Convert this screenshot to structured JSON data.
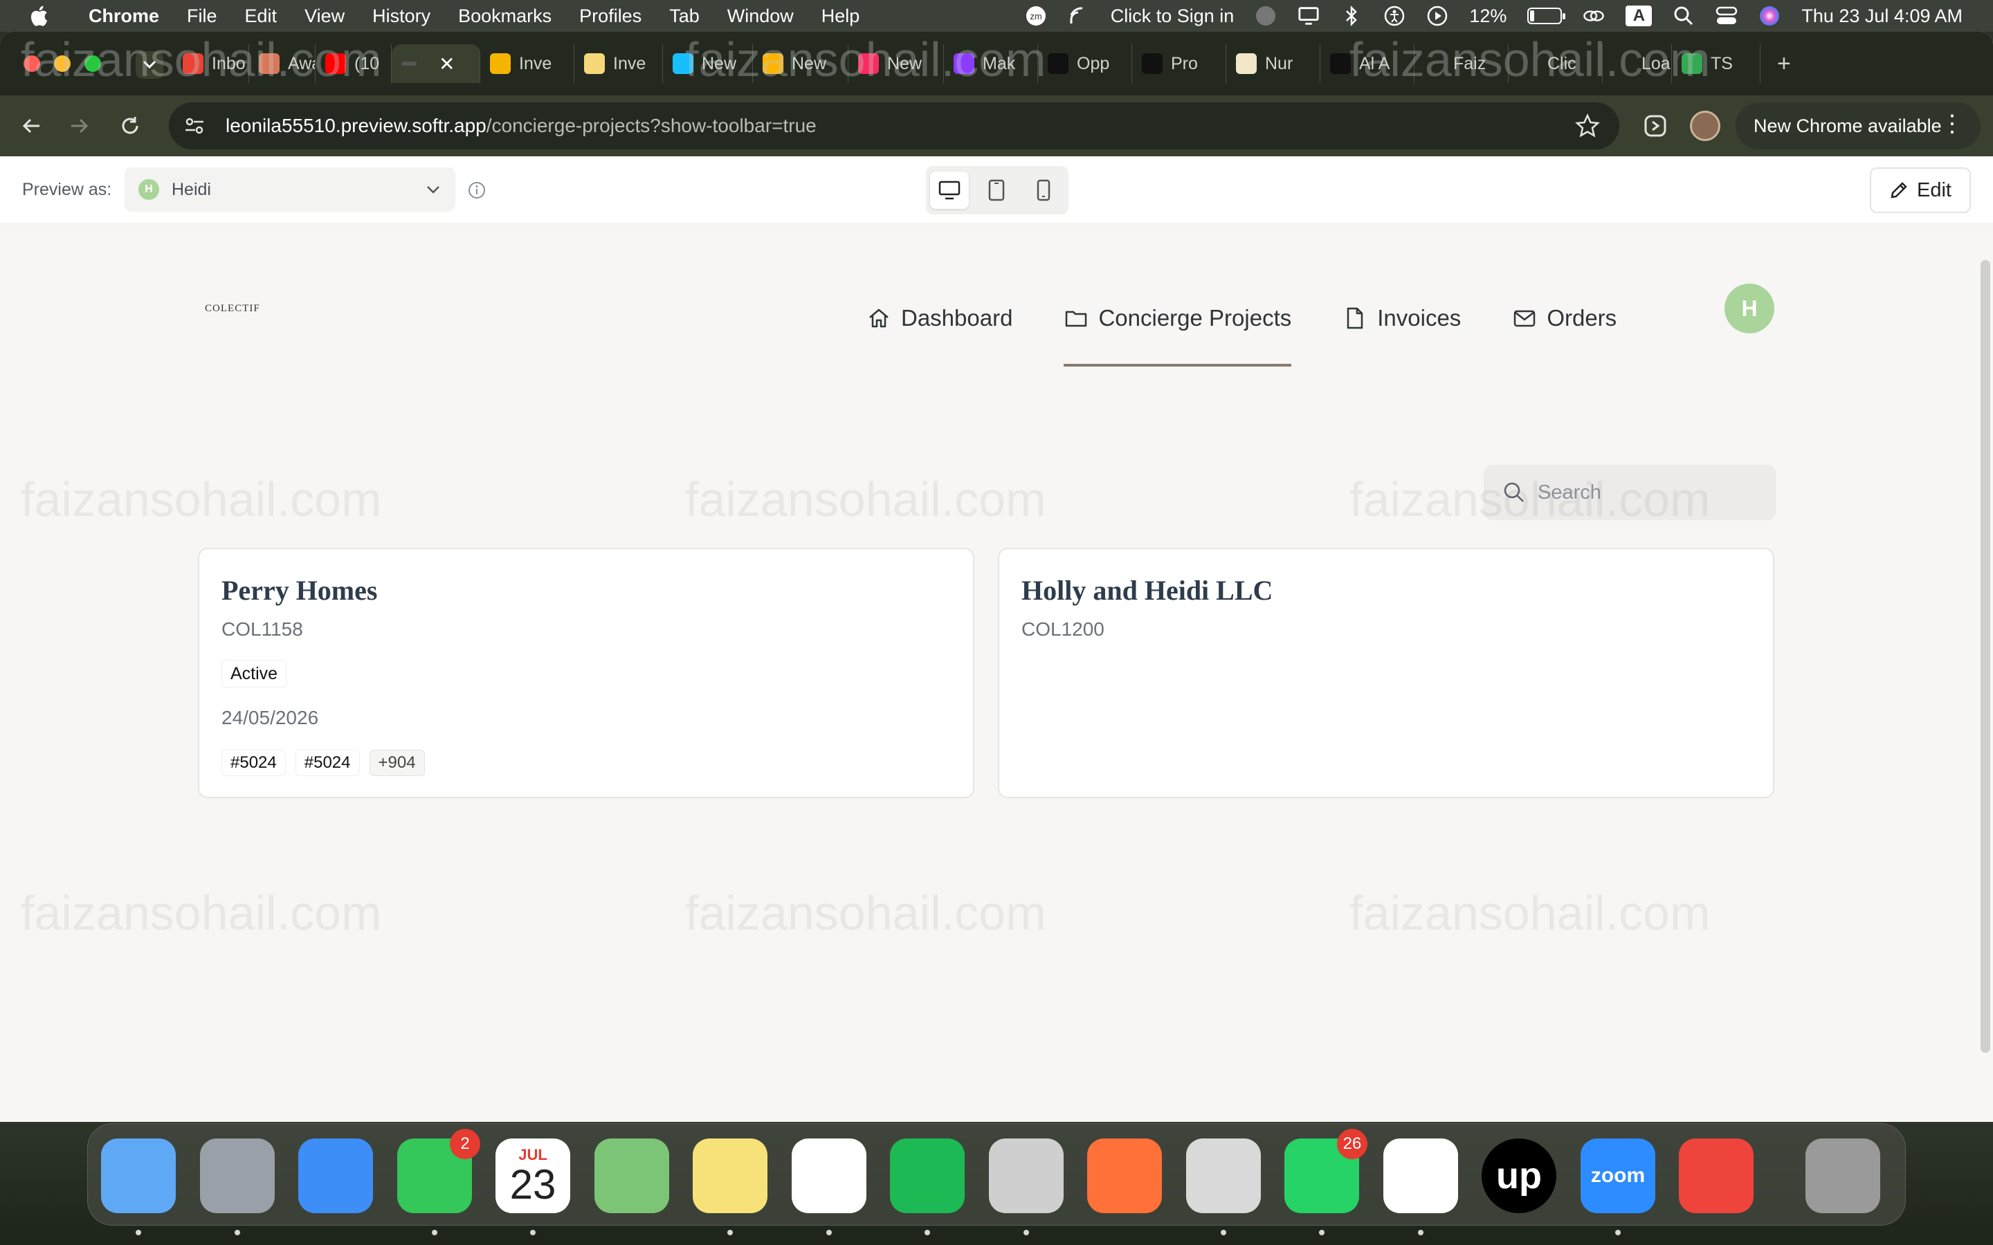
{
  "menubar": {
    "app_name": "Chrome",
    "menus": [
      "File",
      "Edit",
      "View",
      "History",
      "Bookmarks",
      "Profiles",
      "Tab",
      "Window",
      "Help"
    ],
    "sign_in": "Click to Sign in",
    "battery_percent": "12%",
    "input_source": "A",
    "datetime": "Thu 23 Jul  4:09 AM"
  },
  "browser": {
    "tabs": [
      {
        "label": "Inbo",
        "icon": "gmail-icon",
        "color": "#ea4335"
      },
      {
        "label": "Awa",
        "icon": "claude-icon",
        "color": "#d97757"
      },
      {
        "label": "(10",
        "icon": "youtube-icon",
        "color": "#ff0000"
      },
      {
        "label": "",
        "icon": "softr-icon",
        "color": "#555555"
      },
      {
        "label": "Inve",
        "icon": "grid-icon",
        "color": "#f4b400"
      },
      {
        "label": "Inve",
        "icon": "sheet-icon",
        "color": "#f6d77a"
      },
      {
        "label": "New",
        "icon": "airtable-icon",
        "color": "#18bfff"
      },
      {
        "label": "New",
        "icon": "airtable-icon",
        "color": "#fcb400"
      },
      {
        "label": "New",
        "icon": "airtable-icon",
        "color": "#f82b60"
      },
      {
        "label": "Mak",
        "icon": "make-icon",
        "color": "#8b3dff"
      },
      {
        "label": "Opp",
        "icon": "upwork-icon",
        "color": "#111111"
      },
      {
        "label": "Pro",
        "icon": "upwork-icon",
        "color": "#111111"
      },
      {
        "label": "Nur",
        "icon": "nurture-icon",
        "color": "#f3e7c9"
      },
      {
        "label": "Al A",
        "icon": "upwork-icon",
        "color": "#111111"
      },
      {
        "label": "Faiz",
        "icon": "blank-icon",
        "color": "#23291f"
      },
      {
        "label": "Clic",
        "icon": "blank-icon",
        "color": "#23291f"
      },
      {
        "label": "Loa",
        "icon": "blank-icon",
        "color": "#23291f"
      },
      {
        "label": "TS",
        "icon": "ts-icon",
        "color": "#34a853"
      }
    ],
    "url_host": "leonila55510.preview.softr.app",
    "url_path": "/concierge-projects?show-toolbar=true",
    "update_label": "New Chrome available"
  },
  "preview_bar": {
    "label": "Preview as:",
    "user_initial": "H",
    "user_name": "Heidi",
    "edit_label": "Edit"
  },
  "app": {
    "logo": "COLECTIF",
    "nav": [
      {
        "label": "Dashboard",
        "icon": "home-icon"
      },
      {
        "label": "Concierge Projects",
        "icon": "folder-icon",
        "active": true
      },
      {
        "label": "Invoices",
        "icon": "document-icon"
      },
      {
        "label": "Orders",
        "icon": "mail-icon"
      }
    ],
    "avatar_initial": "H",
    "search_placeholder": "Search",
    "cards": [
      {
        "title": "Perry Homes",
        "code": "COL1158",
        "status": "Active",
        "date": "24/05/2026",
        "tags": [
          "#5024",
          "#5024"
        ],
        "more": "+904"
      },
      {
        "title": "Holly and Heidi LLC",
        "code": "COL1200"
      }
    ]
  },
  "watermark": "faizansohail.com",
  "dock": {
    "apps": [
      {
        "name": "Finder",
        "icon": "finder-icon",
        "color": "#5fa8f5"
      },
      {
        "name": "Launchpad",
        "icon": "launchpad-icon",
        "color": "#9aa0a8"
      },
      {
        "name": "Mail",
        "icon": "mail-app-icon",
        "color": "#3d8ef7"
      },
      {
        "name": "Messages",
        "icon": "messages-icon",
        "color": "#34c759",
        "badge": "2"
      },
      {
        "name": "Calendar",
        "icon": "calendar-icon",
        "color": "#ffffff",
        "month": "JUL",
        "day": "23"
      },
      {
        "name": "Maps",
        "icon": "maps-icon",
        "color": "#7cc576"
      },
      {
        "name": "Notes",
        "icon": "notes-icon",
        "color": "#f7e27a"
      },
      {
        "name": "Chrome",
        "icon": "chrome-icon",
        "color": "#ffffff"
      },
      {
        "name": "Spotify",
        "icon": "spotify-icon",
        "color": "#1db954"
      },
      {
        "name": "Calculator",
        "icon": "calculator-icon",
        "color": "#cfcfcf"
      },
      {
        "name": "Firefox",
        "icon": "firefox-icon",
        "color": "#ff7139"
      },
      {
        "name": "iPhone Mirroring",
        "icon": "iphone-icon",
        "color": "#d9d9d9"
      },
      {
        "name": "WhatsApp",
        "icon": "whatsapp-icon",
        "color": "#25d366",
        "badge": "26"
      },
      {
        "name": "Slack",
        "icon": "slack-icon",
        "color": "#ffffff"
      },
      {
        "name": "Upwork",
        "icon": "upwork-icon",
        "color": "#000000",
        "text": "up"
      },
      {
        "name": "Zoom",
        "icon": "zoom-icon",
        "color": "#2d8cff",
        "text": "zoom"
      },
      {
        "name": "AnyDesk",
        "icon": "anydesk-icon",
        "color": "#ef443b"
      },
      {
        "name": "Trash",
        "icon": "trash-icon",
        "color": "#9a9a9a"
      }
    ]
  }
}
